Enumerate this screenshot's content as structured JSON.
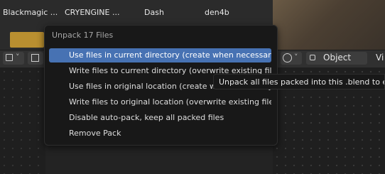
{
  "file_browser": {
    "columns": [
      "Blackmagic ...",
      "CRYENGINE ...",
      "Dash",
      "den4b"
    ]
  },
  "header": {
    "object_mode": "Object",
    "view_label": "Vi",
    "left_icon_chevron": "˅"
  },
  "menu": {
    "title": "Unpack 17 Files",
    "items": [
      {
        "label": "Use files in current directory (create when necessary)"
      },
      {
        "label": "Write files to current directory (overwrite existing files)"
      },
      {
        "label": "Use files in original location (create when necessary)"
      },
      {
        "label": "Write files to original location (overwrite existing files)"
      },
      {
        "label": "Disable auto-pack, keep all packed files"
      },
      {
        "label": "Remove Pack"
      }
    ]
  },
  "tooltip": {
    "text": "Unpack all files packed into this .blend to external ones"
  },
  "colors": {
    "highlight": "#4772b3",
    "menu_bg": "#181818",
    "folder": "#b98f30"
  }
}
